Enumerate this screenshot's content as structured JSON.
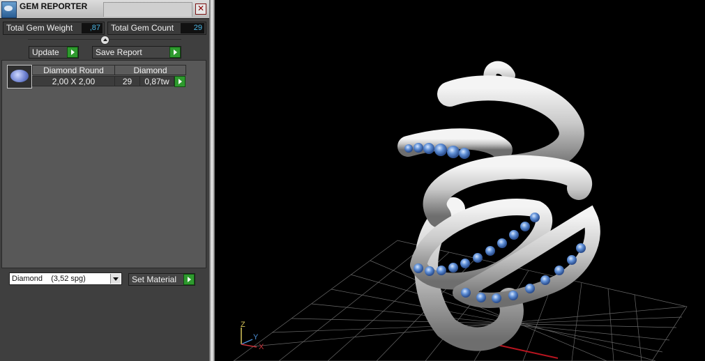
{
  "window": {
    "title": "GEM REPORTER",
    "close_glyph": "✕"
  },
  "stats": {
    "weight_label": "Total Gem Weight",
    "weight_value": ",87",
    "count_label": "Total Gem Count",
    "count_value": "29"
  },
  "toolbar": {
    "update_label": "Update",
    "save_label": "Save Report"
  },
  "gems": [
    {
      "type": "Diamond Round",
      "size": "2,00 X 2,00",
      "material": "Diamond",
      "count": "29",
      "weight": "0,87tw"
    }
  ],
  "material_select": {
    "value": "Diamond",
    "detail": "(3,52 spg)"
  },
  "set_material_label": "Set Material",
  "axes": {
    "z": "Z",
    "y": "Y",
    "x": "X"
  },
  "colors": {
    "accent_green": "#2e9a2e",
    "value_blue": "#4cb6e4",
    "gem_blue": "#5f8fd6",
    "grid": "#6a6a6a"
  }
}
